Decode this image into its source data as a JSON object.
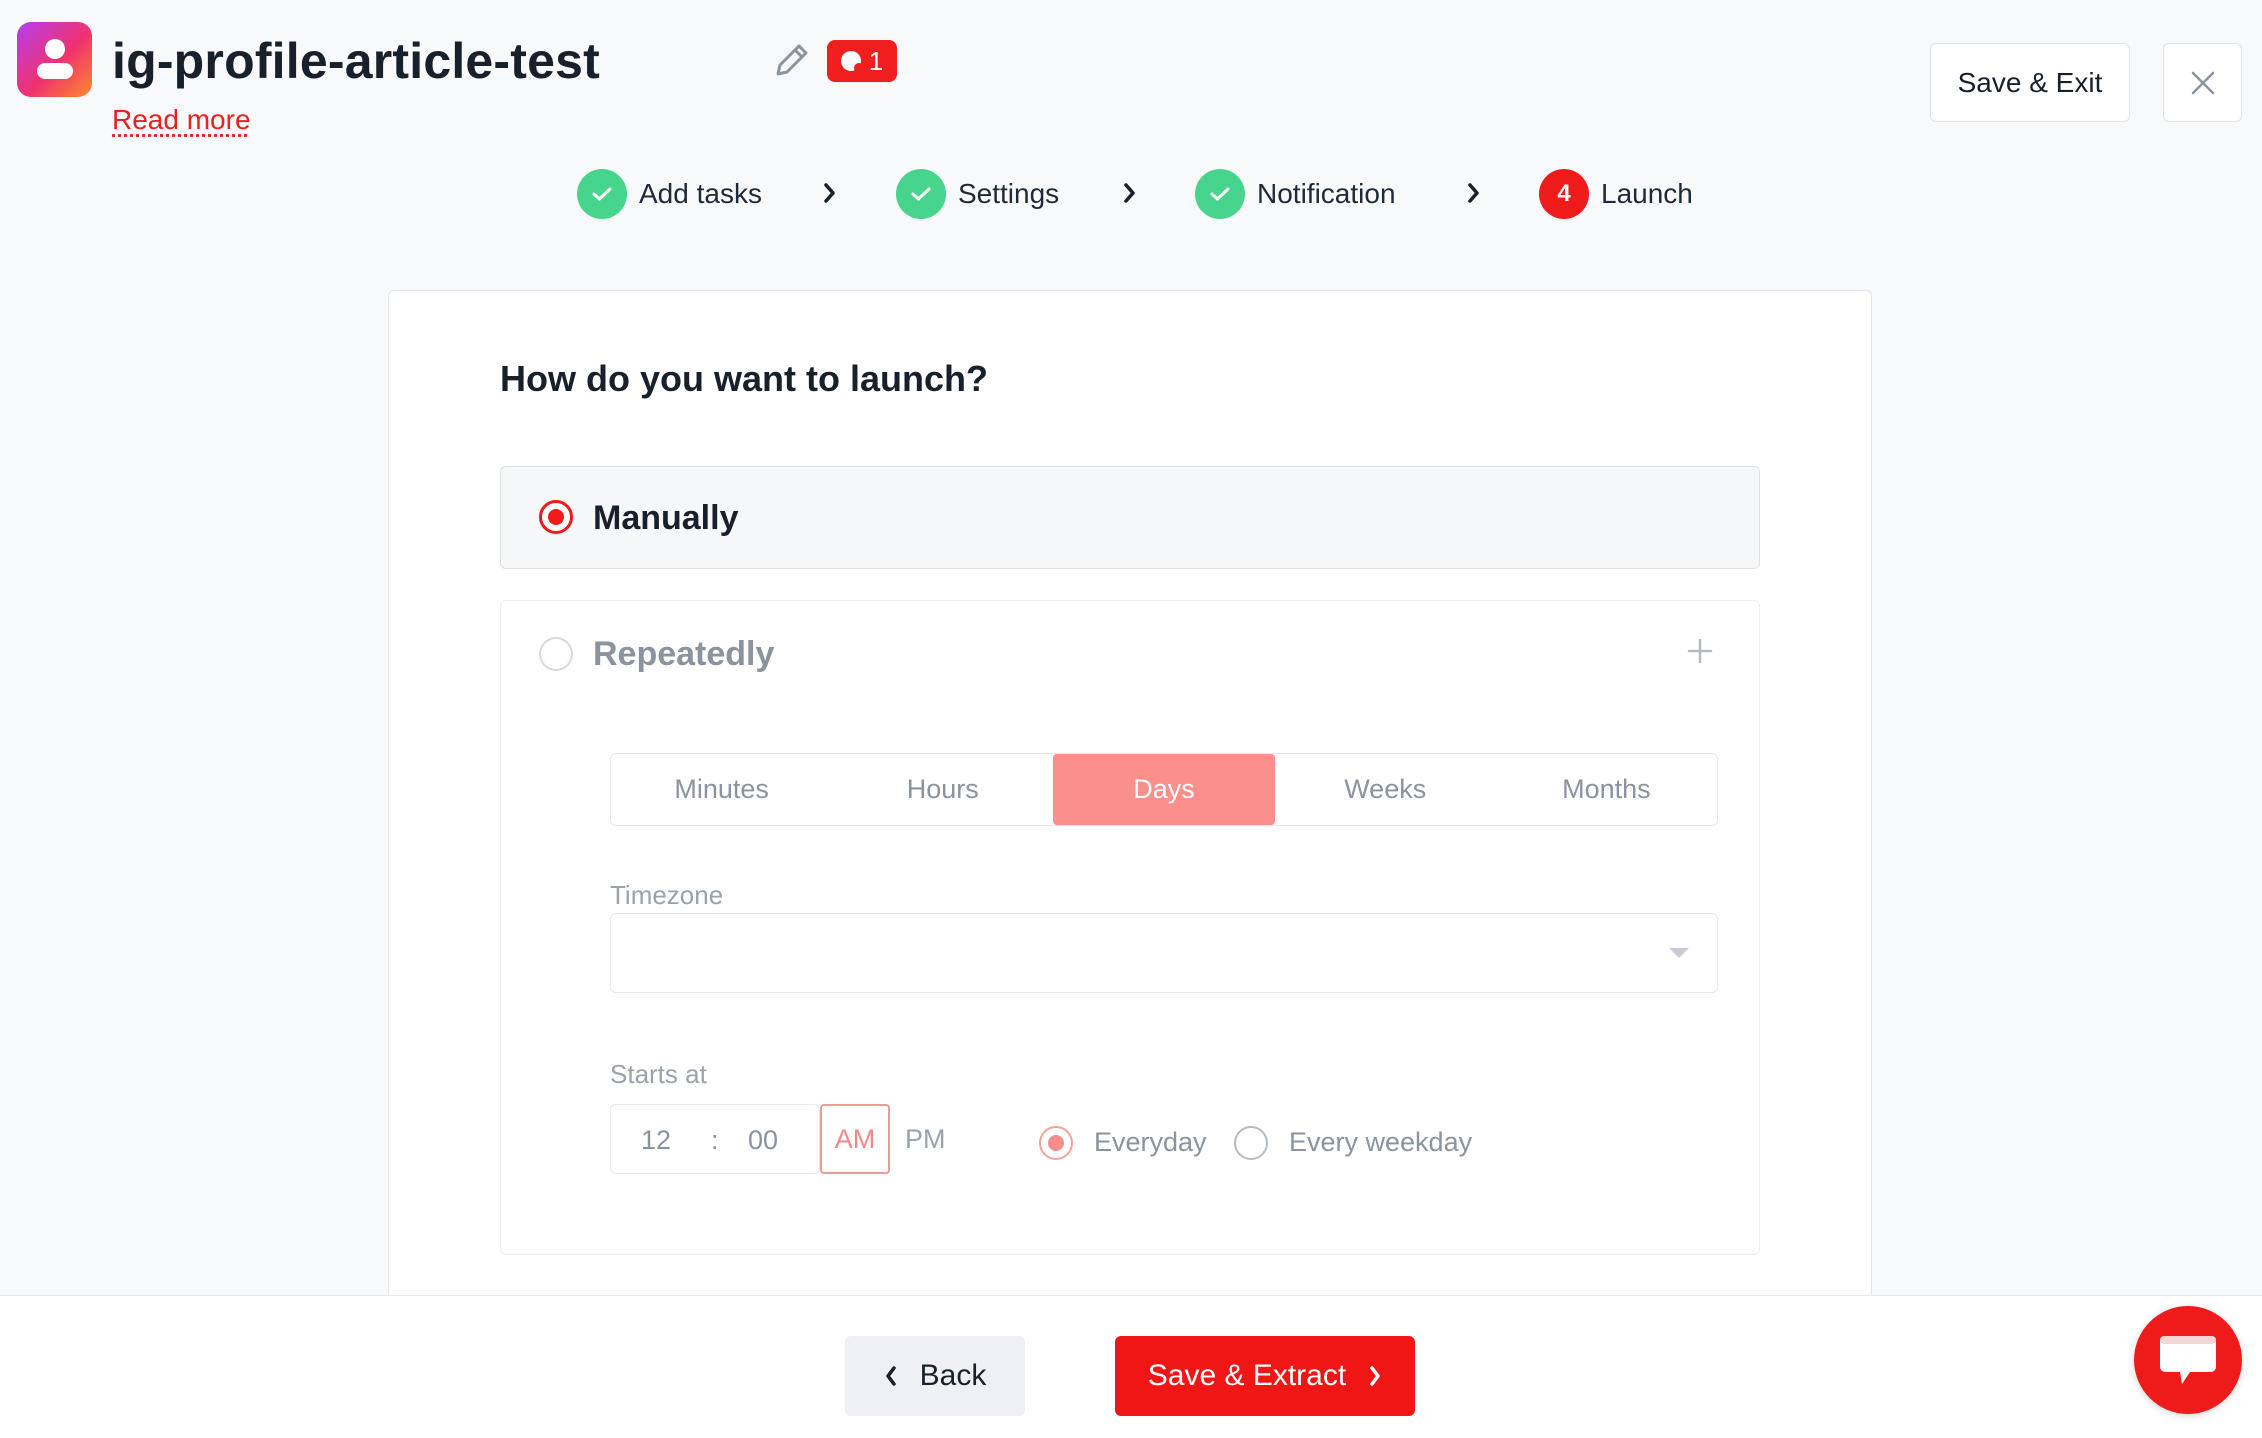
{
  "header": {
    "title": "ig-profile-article-test",
    "read_more": "Read more",
    "badge_count": "1",
    "save_exit_label": "Save & Exit"
  },
  "stepper": {
    "steps": [
      {
        "label": "Add tasks",
        "state": "done"
      },
      {
        "label": "Settings",
        "state": "done"
      },
      {
        "label": "Notification",
        "state": "done"
      },
      {
        "label": "Launch",
        "state": "active",
        "number": "4"
      }
    ]
  },
  "launch": {
    "question": "How do you want to launch?",
    "options": [
      {
        "label": "Manually",
        "selected": true
      },
      {
        "label": "Repeatedly",
        "selected": false
      }
    ],
    "intervals": [
      "Minutes",
      "Hours",
      "Days",
      "Weeks",
      "Months"
    ],
    "selected_interval": "Days",
    "timezone_label": "Timezone",
    "timezone_value": "",
    "starts_at_label": "Starts at",
    "time": {
      "hour": "12",
      "separator": ":",
      "minute": "00",
      "am": "AM",
      "pm": "PM",
      "selected": "AM"
    },
    "frequency": [
      {
        "label": "Everyday",
        "selected": true
      },
      {
        "label": "Every weekday",
        "selected": false
      }
    ]
  },
  "footer": {
    "back_label": "Back",
    "save_extract_label": "Save & Extract"
  },
  "colors": {
    "accent": "#f01616",
    "success": "#47d48c",
    "active_segment": "#fb8f8c"
  }
}
